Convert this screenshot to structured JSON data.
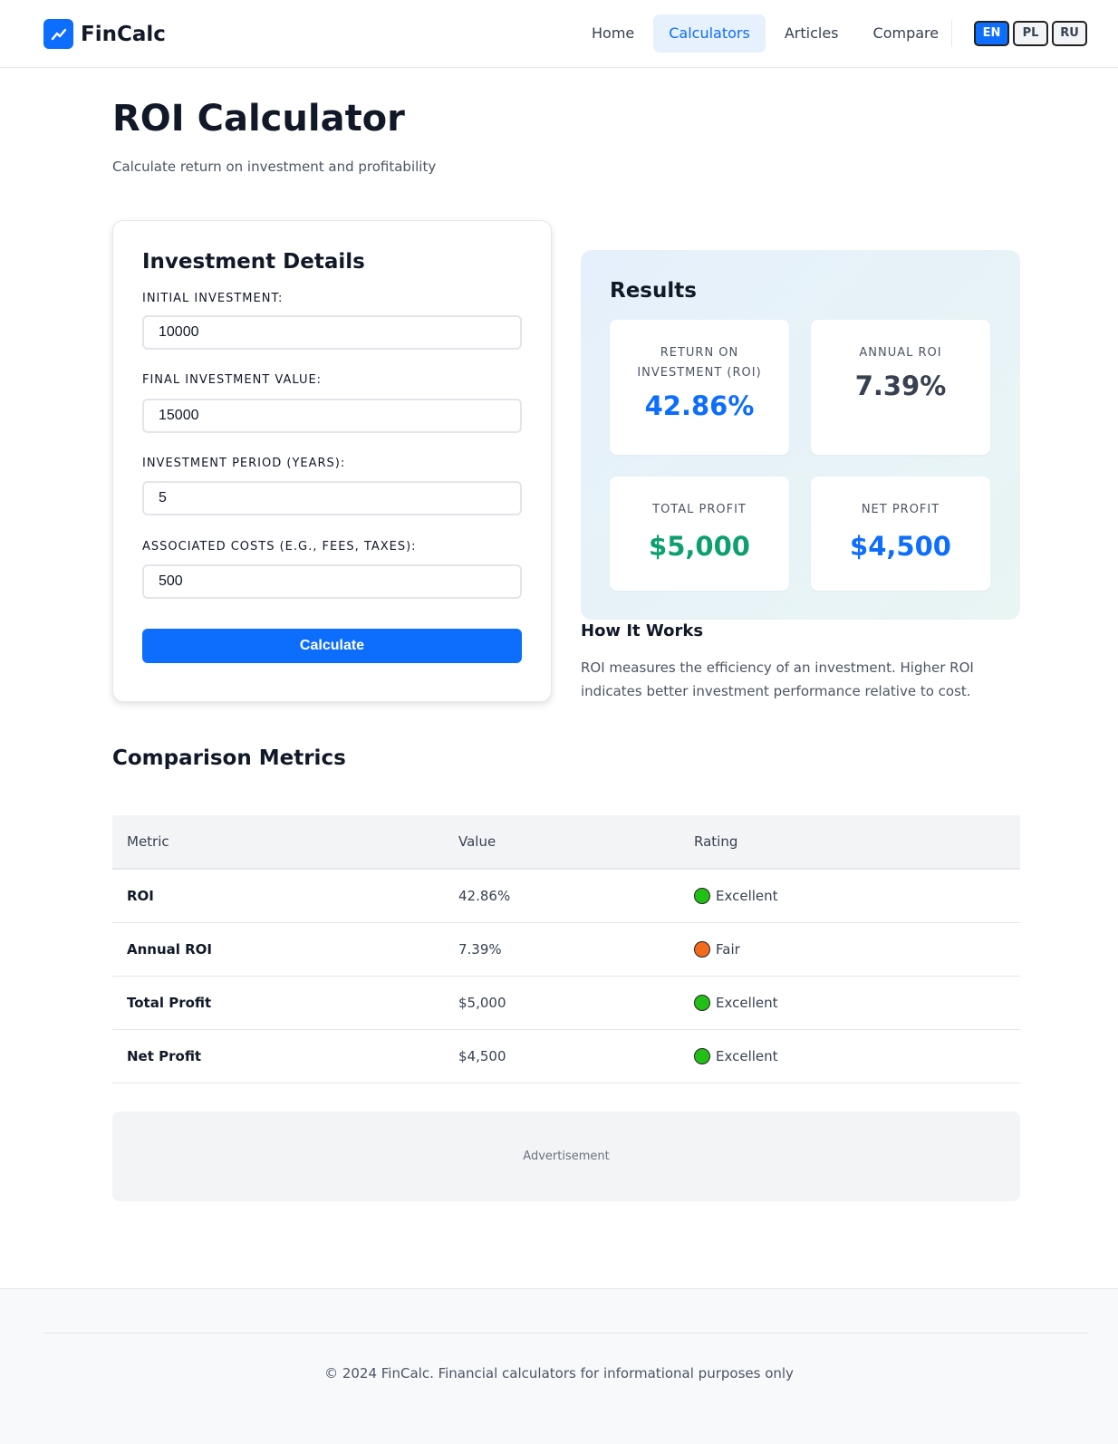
{
  "brand": {
    "name": "FinCalc",
    "icon": "trending-up-icon",
    "color": "#0d6efd"
  },
  "nav": {
    "items": [
      {
        "label": "Home",
        "active": false
      },
      {
        "label": "Calculators",
        "active": true
      },
      {
        "label": "Articles",
        "active": false
      },
      {
        "label": "Compare",
        "active": false
      }
    ]
  },
  "languages": [
    {
      "code": "EN",
      "active": true
    },
    {
      "code": "PL",
      "active": false
    },
    {
      "code": "RU",
      "active": false
    }
  ],
  "page": {
    "title": "ROI Calculator",
    "subtitle": "Calculate return on investment and profitability"
  },
  "form": {
    "title": "Investment Details",
    "fields": [
      {
        "label": "INITIAL INVESTMENT:",
        "value": "10000"
      },
      {
        "label": "FINAL INVESTMENT VALUE:",
        "value": "15000"
      },
      {
        "label": "INVESTMENT PERIOD (YEARS):",
        "value": "5"
      },
      {
        "label": "ASSOCIATED COSTS (E.G., FEES, TAXES):",
        "value": "500"
      }
    ],
    "submit_label": "Calculate"
  },
  "results": {
    "title": "Results",
    "metrics": [
      {
        "label_line1": "RETURN ON",
        "label_line2": "INVESTMENT (ROI)",
        "value": "42.86%",
        "color": "#0d6efd"
      },
      {
        "label_line1": "ANNUAL ROI",
        "label_line2": "",
        "value": "7.39%",
        "color": "#374151"
      },
      {
        "label_line1": "TOTAL PROFIT",
        "label_line2": "",
        "value": "$5,000",
        "color": "#0d9f6e"
      },
      {
        "label_line1": "NET PROFIT",
        "label_line2": "",
        "value": "$4,500",
        "color": "#0d6efd"
      }
    ]
  },
  "how_it_works": {
    "title": "How It Works",
    "text": "ROI measures the efficiency of an investment. Higher ROI indicates better investment performance relative to cost."
  },
  "comparison": {
    "title": "Comparison Metrics",
    "headers": [
      "Metric",
      "Value",
      "Rating"
    ],
    "rows": [
      {
        "metric": "ROI",
        "value": "42.86%",
        "rating": "Excellent",
        "rating_color": "#22c016"
      },
      {
        "metric": "Annual ROI",
        "value": "7.39%",
        "rating": "Fair",
        "rating_color": "#f26b1d"
      },
      {
        "metric": "Total Profit",
        "value": "$5,000",
        "rating": "Excellent",
        "rating_color": "#22c016"
      },
      {
        "metric": "Net Profit",
        "value": "$4,500",
        "rating": "Excellent",
        "rating_color": "#22c016"
      }
    ]
  },
  "ad": {
    "label": "Advertisement"
  },
  "footer": {
    "text": "© 2024 FinCalc. Financial calculators for informational purposes only"
  }
}
